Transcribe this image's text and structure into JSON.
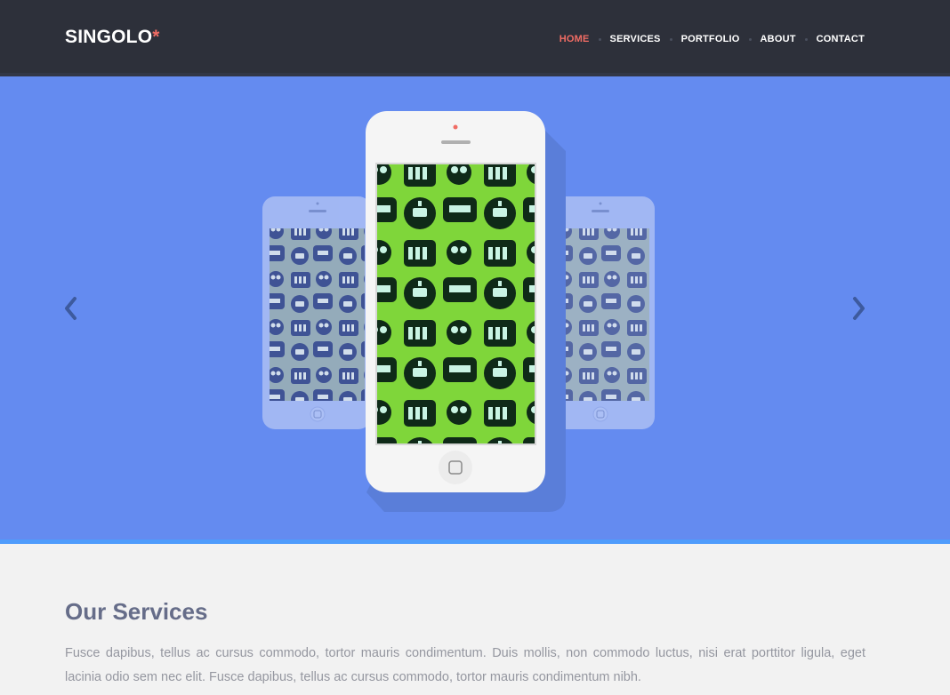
{
  "header": {
    "logo_text": "SINGOLO",
    "logo_star": "*",
    "nav": [
      {
        "label": "HOME",
        "active": true
      },
      {
        "label": "SERVICES",
        "active": false
      },
      {
        "label": "PORTFOLIO",
        "active": false
      },
      {
        "label": "ABOUT",
        "active": false
      },
      {
        "label": "CONTACT",
        "active": false
      }
    ]
  },
  "slider": {
    "prev_icon": "chevron-left-icon",
    "next_icon": "chevron-right-icon",
    "background_color": "#648bf0",
    "accent_border_color": "#4f9cfc"
  },
  "services": {
    "title": "Our Services",
    "text": "Fusce dapibus, tellus ac cursus commodo, tortor mauris condimentum. Duis mollis, non commodo luctus, nisi erat porttitor ligula, eget lacinia odio sem nec elit. Fusce dapibus, tellus ac cursus commodo, tortor mauris condimentum nibh."
  },
  "colors": {
    "header_bg": "#2d303a",
    "accent": "#f06c64",
    "heading": "#666d89",
    "body_text": "#9597a0"
  }
}
